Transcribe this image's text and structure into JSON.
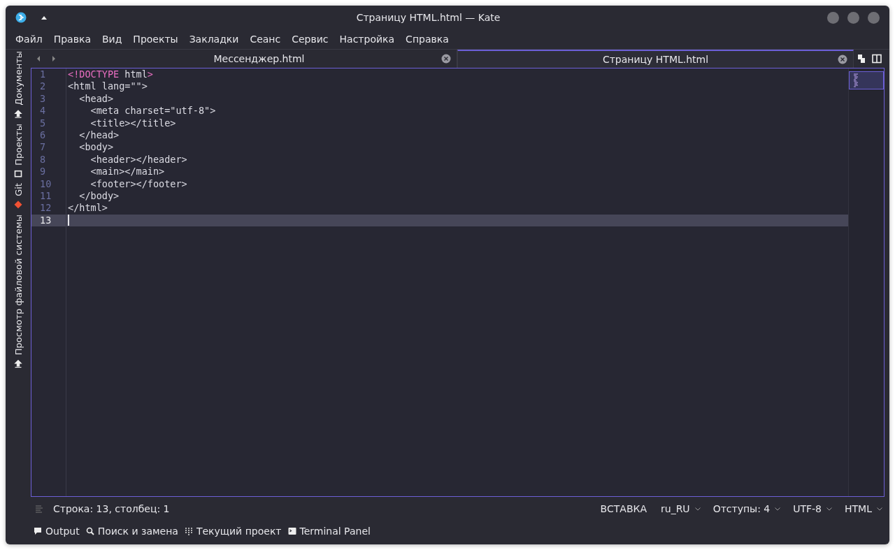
{
  "window": {
    "title": "Страницу HTML.html — Kate"
  },
  "menu": [
    "Файл",
    "Правка",
    "Вид",
    "Проекты",
    "Закладки",
    "Сеанс",
    "Сервис",
    "Настройка",
    "Справка"
  ],
  "sidebar": [
    {
      "label": "Документы",
      "kind": "upload"
    },
    {
      "label": "Проекты",
      "kind": "folder"
    },
    {
      "label": "Git",
      "kind": "git"
    },
    {
      "label": "Просмотр файловой системы",
      "kind": "upload"
    }
  ],
  "tabs": [
    {
      "label": "Мессенджер.html",
      "selected": false
    },
    {
      "label": "Страницу HTML.html",
      "selected": true
    }
  ],
  "editor": {
    "lines": [
      {
        "number": "1",
        "current": false,
        "segments": [
          {
            "text": "<!DOCTYPE",
            "kind": "keyword"
          },
          {
            "text": " html",
            "kind": "text"
          },
          {
            "text": ">",
            "kind": "keyword"
          }
        ]
      },
      {
        "number": "2",
        "current": false,
        "segments": [
          {
            "text": "<html lang=\"\">",
            "kind": "text"
          }
        ]
      },
      {
        "number": "3",
        "current": false,
        "segments": [
          {
            "text": "  <head>",
            "kind": "text"
          }
        ]
      },
      {
        "number": "4",
        "current": false,
        "segments": [
          {
            "text": "    <meta charset=\"utf-8\">",
            "kind": "text"
          }
        ]
      },
      {
        "number": "5",
        "current": false,
        "segments": [
          {
            "text": "    <title></title>",
            "kind": "text"
          }
        ]
      },
      {
        "number": "6",
        "current": false,
        "segments": [
          {
            "text": "  </head>",
            "kind": "text"
          }
        ]
      },
      {
        "number": "7",
        "current": false,
        "segments": [
          {
            "text": "  <body>",
            "kind": "text"
          }
        ]
      },
      {
        "number": "8",
        "current": false,
        "segments": [
          {
            "text": "    <header></header>",
            "kind": "text"
          }
        ]
      },
      {
        "number": "9",
        "current": false,
        "segments": [
          {
            "text": "    <main></main>",
            "kind": "text"
          }
        ]
      },
      {
        "number": "10",
        "current": false,
        "segments": [
          {
            "text": "    <footer></footer>",
            "kind": "text"
          }
        ]
      },
      {
        "number": "11",
        "current": false,
        "segments": [
          {
            "text": "  </body>",
            "kind": "text"
          }
        ]
      },
      {
        "number": "12",
        "current": false,
        "segments": [
          {
            "text": "</html>",
            "kind": "text"
          }
        ]
      },
      {
        "number": "13",
        "current": true
      }
    ]
  },
  "status_bar": {
    "position": "Строка: 13, столбец: 1",
    "mode": "ВСТАВКА",
    "dropdowns": [
      "ru_RU",
      "Отступы: 4",
      "UTF-8",
      "HTML"
    ]
  },
  "tool_views": [
    {
      "label": "Output",
      "kind": "output"
    },
    {
      "label": "Поиск и замена",
      "kind": "search"
    },
    {
      "label": "Текущий проект",
      "kind": "project"
    },
    {
      "label": "Terminal Panel",
      "kind": "terminal"
    }
  ]
}
